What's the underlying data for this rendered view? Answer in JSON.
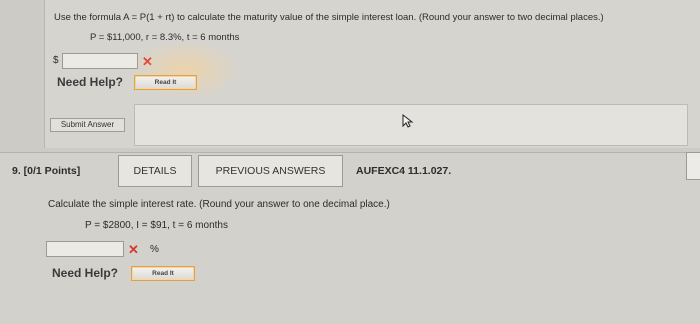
{
  "q8": {
    "formula_text": "Use the formula A = P(1 + rt) to calculate the maturity value of the simple interest loan. (Round your answer to two decimal places.)",
    "vars_text": "P = $11,000, r = 8.3%, t = 6 months",
    "currency_symbol": "$",
    "answer_value": "",
    "wrong_mark": "✕",
    "help_label": "Need Help?",
    "readit_label": "Read It",
    "submit_label": "Submit Answer"
  },
  "q9": {
    "points_label": "9.  [0/1 Points]",
    "details_tab": "DETAILS",
    "prev_answers_tab": "PREVIOUS ANSWERS",
    "problem_code": "AUFEXC4 11.1.027.",
    "question_text": "Calculate the simple interest rate. (Round your answer to one decimal place.)",
    "vars_text": "P = $2800, I = $91, t = 6 months",
    "answer_value": "",
    "wrong_mark": "✕",
    "unit": "%",
    "help_label": "Need Help?",
    "readit_label": "Read It"
  },
  "colors": {
    "background": "#cdcbc6",
    "wrong_mark": "#d9362a",
    "readit_border": "#e0a14a"
  },
  "icons": [
    "close-icon",
    "mouse-cursor-icon"
  ]
}
